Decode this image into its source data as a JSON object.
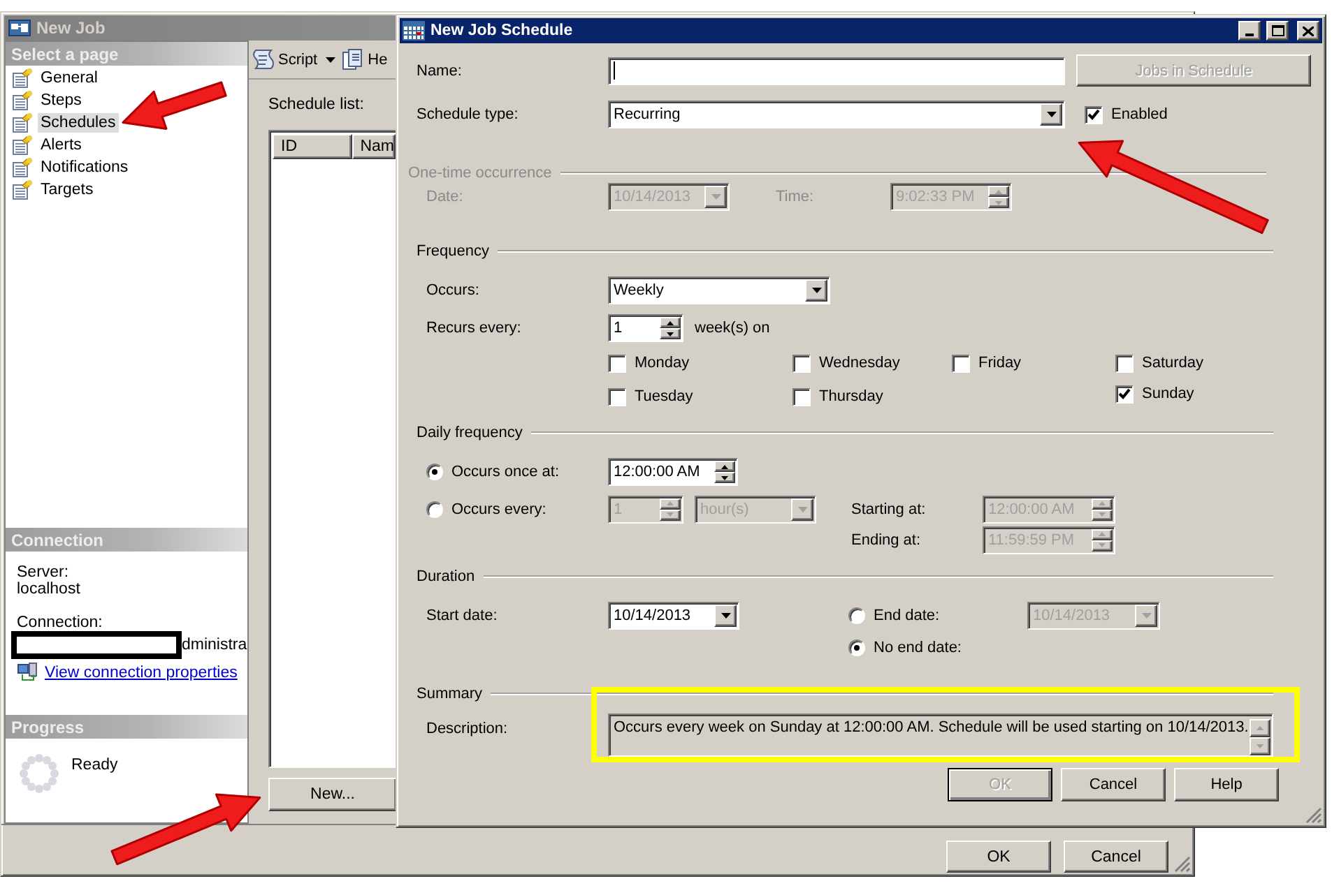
{
  "main_window": {
    "title": "New Job",
    "pages_header": "Select a page",
    "pages": [
      {
        "label": "General",
        "selected": false
      },
      {
        "label": "Steps",
        "selected": false
      },
      {
        "label": "Schedules",
        "selected": true
      },
      {
        "label": "Alerts",
        "selected": false
      },
      {
        "label": "Notifications",
        "selected": false
      },
      {
        "label": "Targets",
        "selected": false
      }
    ],
    "connection": {
      "header": "Connection",
      "server_label": "Server:",
      "server": "localhost",
      "connection_label": "Connection:",
      "connection_value": "dministra",
      "link": "View connection properties"
    },
    "progress": {
      "header": "Progress",
      "status": "Ready"
    },
    "toolbar": [
      {
        "label": "Script",
        "kind": "dropdown"
      },
      {
        "label": "He",
        "kind": "button"
      }
    ],
    "schedule_list": {
      "label": "Schedule list:",
      "columns": [
        "ID",
        "Nam"
      ]
    },
    "new_button": "New...",
    "buttons": [
      "OK",
      "Cancel"
    ]
  },
  "dialog": {
    "title": "New Job Schedule",
    "name": {
      "label": "Name:"
    },
    "jobs_button": {
      "label": "Jobs in Schedule",
      "disabled": true
    },
    "schedule_type": {
      "label": "Schedule type:",
      "value": "Recurring"
    },
    "enabled": {
      "label": "Enabled",
      "checked": true
    },
    "one_time": {
      "title": "One-time occurrence",
      "disabled": true,
      "date_label": "Date:",
      "date": "10/14/2013",
      "time_label": "Time:",
      "time": "9:02:33 PM"
    },
    "frequency": {
      "title": "Frequency",
      "occurs_label": "Occurs:",
      "occurs": "Weekly",
      "recurs_label": "Recurs every:",
      "recurs": "1",
      "recurs_unit": "week(s) on",
      "days": [
        {
          "label": "Monday",
          "checked": false
        },
        {
          "label": "Tuesday",
          "checked": false
        },
        {
          "label": "Wednesday",
          "checked": false
        },
        {
          "label": "Thursday",
          "checked": false
        },
        {
          "label": "Friday",
          "checked": false
        },
        {
          "label": "Saturday",
          "checked": false
        },
        {
          "label": "Sunday",
          "checked": true
        }
      ]
    },
    "daily": {
      "title": "Daily frequency",
      "options": [
        {
          "label": "Occurs once at:",
          "selected": true,
          "time": "12:00:00 AM"
        },
        {
          "label": "Occurs every:",
          "selected": false,
          "interval": "1",
          "unit": "hour(s)"
        }
      ],
      "start_label": "Starting at:",
      "start": "12:00:00 AM",
      "end_label": "Ending at:",
      "end": "11:59:59 PM"
    },
    "duration": {
      "title": "Duration",
      "start_label": "Start date:",
      "start": "10/14/2013",
      "end_options": [
        {
          "label": "End date:",
          "selected": false,
          "date": "10/14/2013"
        },
        {
          "label": "No end date:",
          "selected": true
        }
      ]
    },
    "summary": {
      "title": "Summary",
      "description_label": "Description:",
      "description": "Occurs every week on Sunday at 12:00:00 AM. Schedule will be used starting on 10/14/2013."
    },
    "buttons": [
      {
        "label": "OK",
        "disabled": true
      },
      {
        "label": "Cancel",
        "disabled": false
      },
      {
        "label": "Help",
        "disabled": false
      }
    ]
  }
}
